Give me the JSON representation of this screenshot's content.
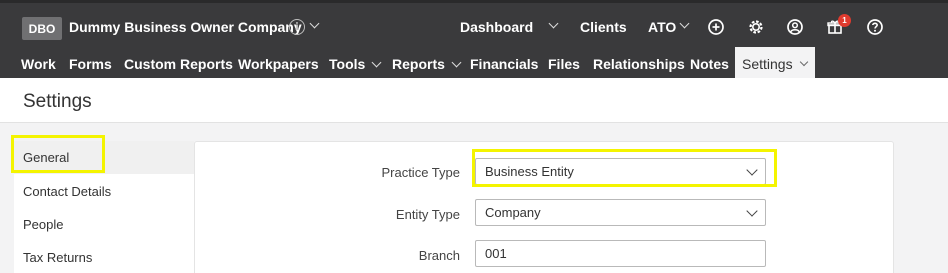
{
  "header": {
    "company_badge": "DBO",
    "company_name": "Dummy Business Owner Company",
    "links": {
      "dashboard": "Dashboard",
      "clients": "Clients",
      "ato": "ATO"
    },
    "notification_count": "1"
  },
  "nav": {
    "items": [
      "Work",
      "Forms",
      "Custom Reports",
      "Workpapers",
      "Tools",
      "Reports",
      "Financials",
      "Files",
      "Relationships",
      "Notes",
      "Settings"
    ],
    "active": "Settings"
  },
  "page": {
    "title": "Settings"
  },
  "sidebar": {
    "items": [
      {
        "label": "General",
        "active": true
      },
      {
        "label": "Contact Details",
        "active": false
      },
      {
        "label": "People",
        "active": false
      },
      {
        "label": "Tax Returns",
        "active": false
      }
    ]
  },
  "form": {
    "practice_type": {
      "label": "Practice Type",
      "value": "Business Entity"
    },
    "entity_type": {
      "label": "Entity Type",
      "value": "Company"
    },
    "branch": {
      "label": "Branch",
      "value": "001"
    }
  },
  "colors": {
    "topbar": "#3a3a3c",
    "highlight": "#f4f400",
    "notification": "#e03b2f"
  }
}
